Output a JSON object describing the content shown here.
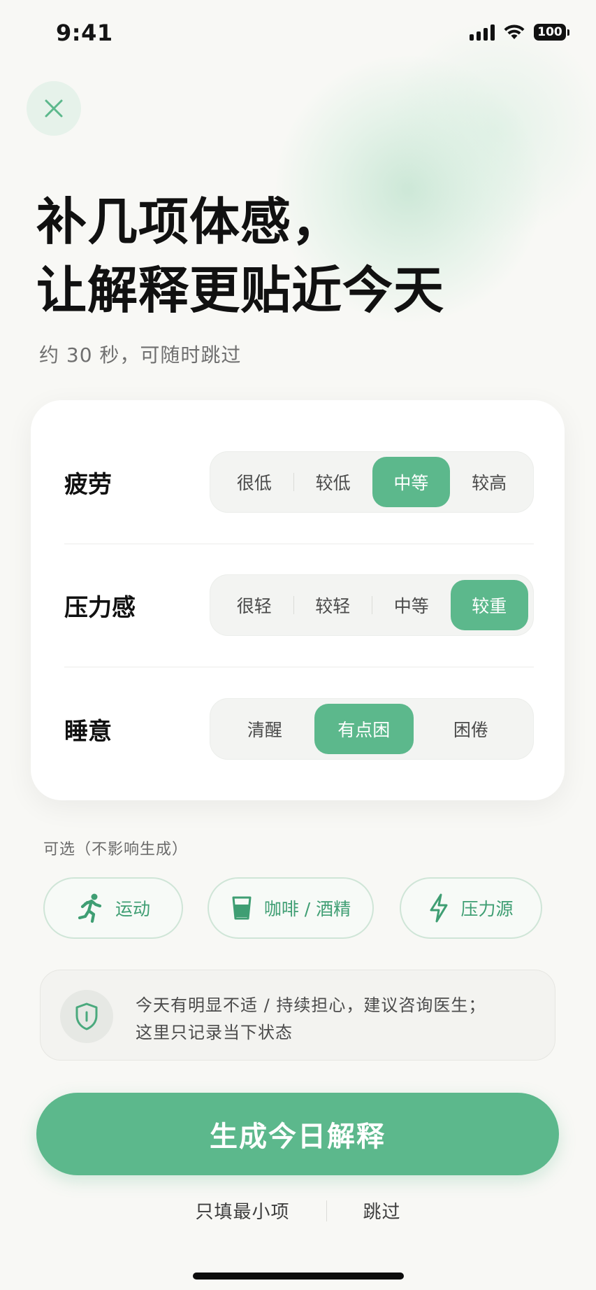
{
  "status_bar": {
    "time": "9:41",
    "battery": "100"
  },
  "header": {
    "title_line1": "补几项体感，",
    "title_line2": "让解释更贴近今天",
    "subtitle": "约 30 秒，可随时跳过"
  },
  "questions": [
    {
      "label": "疲劳",
      "options": [
        "很低",
        "较低",
        "中等",
        "较高"
      ],
      "selected": "中等"
    },
    {
      "label": "压力感",
      "options": [
        "很轻",
        "较轻",
        "中等",
        "较重"
      ],
      "selected": "较重"
    },
    {
      "label": "睡意",
      "options": [
        "清醒",
        "有点困",
        "困倦"
      ],
      "selected": "有点困"
    }
  ],
  "optional": {
    "label": "可选（不影响生成）",
    "chips": [
      {
        "label": "运动",
        "icon": "running-icon"
      },
      {
        "label": "咖啡 / 酒精",
        "icon": "cup-icon"
      },
      {
        "label": "压力源",
        "icon": "lightning-icon"
      }
    ]
  },
  "notice": {
    "line1": "今天有明显不适 / 持续担心，建议咨询医生；",
    "line2": "这里只记录当下状态",
    "icon": "shield-icon"
  },
  "actions": {
    "primary": "生成今日解释",
    "minimal": "只填最小项",
    "skip": "跳过"
  },
  "colors": {
    "accent": "#5cb88c",
    "accent_text": "#3f9e73",
    "background": "#f8f8f5"
  }
}
